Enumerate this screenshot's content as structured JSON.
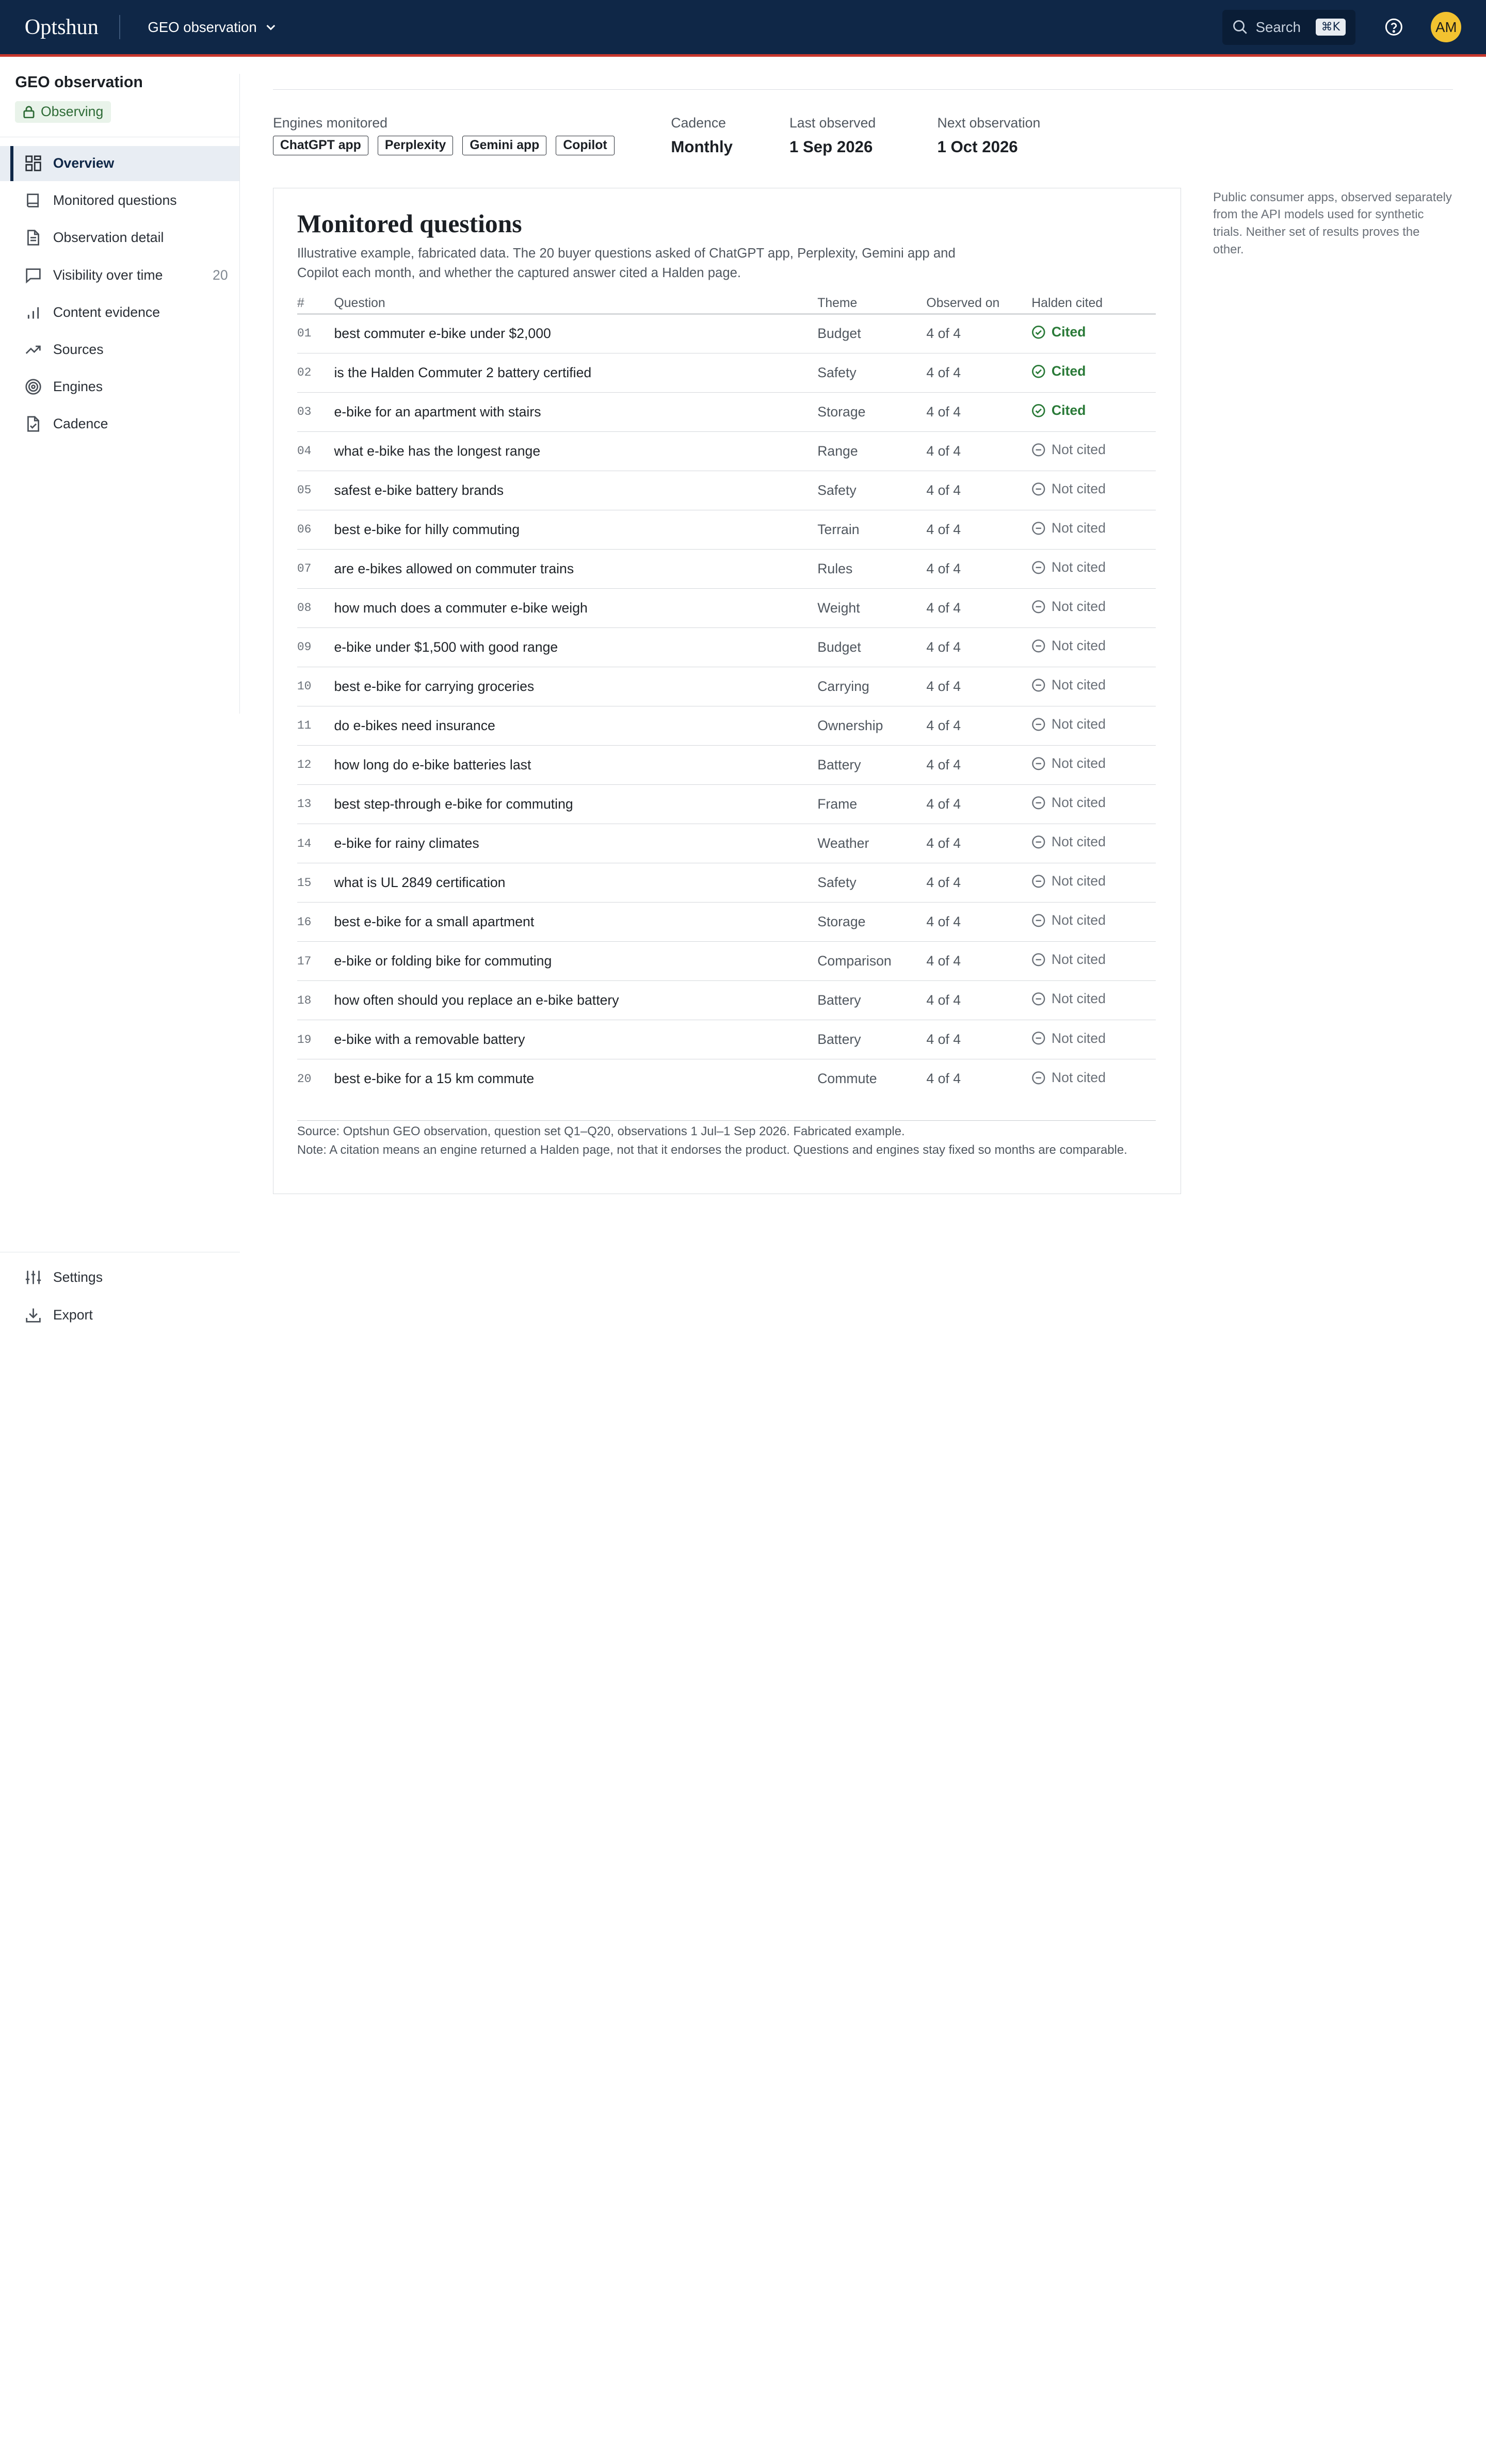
{
  "app": {
    "brand": "Optshun",
    "context": "GEO observation"
  },
  "topbar": {
    "search_label": "Search",
    "search_shortcut": "⌘K",
    "avatar_initials": "AM"
  },
  "sidebar": {
    "title": "GEO observation",
    "status": "Observing",
    "items": [
      {
        "label": "Overview",
        "icon": "grid-icon",
        "active": true
      },
      {
        "label": "Monitored questions",
        "icon": "book-icon"
      },
      {
        "label": "Observation detail",
        "icon": "document-icon"
      },
      {
        "label": "Visibility over time",
        "icon": "chat-icon",
        "count": "20"
      },
      {
        "label": "Content evidence",
        "icon": "bar-chart-icon"
      },
      {
        "label": "Sources",
        "icon": "trend-icon"
      },
      {
        "label": "Engines",
        "icon": "target-icon"
      },
      {
        "label": "Cadence",
        "icon": "file-check-icon"
      }
    ],
    "bottom": [
      {
        "label": "Settings",
        "icon": "sliders-icon"
      },
      {
        "label": "Export",
        "icon": "download-icon"
      }
    ]
  },
  "meta": {
    "engines_label": "Engines monitored",
    "engines": [
      "ChatGPT app",
      "Perplexity",
      "Gemini app",
      "Copilot"
    ],
    "cadence_label": "Cadence",
    "cadence_value": "Monthly",
    "last_label": "Last observed",
    "last_value": "1 Sep 2026",
    "next_label": "Next observation",
    "next_value": "1 Oct 2026"
  },
  "card": {
    "title": "Monitored questions",
    "description": "Illustrative example, fabricated data. The 20 buyer questions asked of ChatGPT app, Perplexity, Gemini app and Copilot each month, and whether the captured answer cited a Halden page.",
    "columns": [
      "#",
      "Question",
      "Theme",
      "Observed on",
      "Halden cited"
    ],
    "rows": [
      {
        "num": "01",
        "question": "best commuter e-bike under $2,000",
        "theme": "Budget",
        "observed": "4 of 4",
        "cited": "Cited",
        "is_cited": true
      },
      {
        "num": "02",
        "question": "is the Halden Commuter 2 battery certified",
        "theme": "Safety",
        "observed": "4 of 4",
        "cited": "Cited",
        "is_cited": true
      },
      {
        "num": "03",
        "question": "e-bike for an apartment with stairs",
        "theme": "Storage",
        "observed": "4 of 4",
        "cited": "Cited",
        "is_cited": true
      },
      {
        "num": "04",
        "question": "what e-bike has the longest range",
        "theme": "Range",
        "observed": "4 of 4",
        "cited": "Not cited",
        "is_cited": false
      },
      {
        "num": "05",
        "question": "safest e-bike battery brands",
        "theme": "Safety",
        "observed": "4 of 4",
        "cited": "Not cited",
        "is_cited": false
      },
      {
        "num": "06",
        "question": "best e-bike for hilly commuting",
        "theme": "Terrain",
        "observed": "4 of 4",
        "cited": "Not cited",
        "is_cited": false
      },
      {
        "num": "07",
        "question": "are e-bikes allowed on commuter trains",
        "theme": "Rules",
        "observed": "4 of 4",
        "cited": "Not cited",
        "is_cited": false
      },
      {
        "num": "08",
        "question": "how much does a commuter e-bike weigh",
        "theme": "Weight",
        "observed": "4 of 4",
        "cited": "Not cited",
        "is_cited": false
      },
      {
        "num": "09",
        "question": "e-bike under $1,500 with good range",
        "theme": "Budget",
        "observed": "4 of 4",
        "cited": "Not cited",
        "is_cited": false
      },
      {
        "num": "10",
        "question": "best e-bike for carrying groceries",
        "theme": "Carrying",
        "observed": "4 of 4",
        "cited": "Not cited",
        "is_cited": false
      },
      {
        "num": "11",
        "question": "do e-bikes need insurance",
        "theme": "Ownership",
        "observed": "4 of 4",
        "cited": "Not cited",
        "is_cited": false
      },
      {
        "num": "12",
        "question": "how long do e-bike batteries last",
        "theme": "Battery",
        "observed": "4 of 4",
        "cited": "Not cited",
        "is_cited": false
      },
      {
        "num": "13",
        "question": "best step-through e-bike for commuting",
        "theme": "Frame",
        "observed": "4 of 4",
        "cited": "Not cited",
        "is_cited": false
      },
      {
        "num": "14",
        "question": "e-bike for rainy climates",
        "theme": "Weather",
        "observed": "4 of 4",
        "cited": "Not cited",
        "is_cited": false
      },
      {
        "num": "15",
        "question": "what is UL 2849 certification",
        "theme": "Safety",
        "observed": "4 of 4",
        "cited": "Not cited",
        "is_cited": false
      },
      {
        "num": "16",
        "question": "best e-bike for a small apartment",
        "theme": "Storage",
        "observed": "4 of 4",
        "cited": "Not cited",
        "is_cited": false
      },
      {
        "num": "17",
        "question": "e-bike or folding bike for commuting",
        "theme": "Comparison",
        "observed": "4 of 4",
        "cited": "Not cited",
        "is_cited": false
      },
      {
        "num": "18",
        "question": "how often should you replace an e-bike battery",
        "theme": "Battery",
        "observed": "4 of 4",
        "cited": "Not cited",
        "is_cited": false
      },
      {
        "num": "19",
        "question": "e-bike with a removable battery",
        "theme": "Battery",
        "observed": "4 of 4",
        "cited": "Not cited",
        "is_cited": false
      },
      {
        "num": "20",
        "question": "best e-bike for a 15 km commute",
        "theme": "Commute",
        "observed": "4 of 4",
        "cited": "Not cited",
        "is_cited": false
      }
    ],
    "source": "Source: Optshun GEO observation, question set Q1–Q20, observations 1 Jul–1 Sep 2026. Fabricated example.",
    "note": "Note: A citation means an engine returned a Halden page, not that it endorses the product. Questions and engines stay fixed so months are comparable."
  },
  "aside": "Public consumer apps, observed separately from the API models used for synthetic trials. Neither set of results proves the other.",
  "colors": {
    "navy": "#0f2747",
    "accent_red": "#c8372d",
    "cited_green": "#2a7a38",
    "avatar_yellow": "#f2c230"
  }
}
